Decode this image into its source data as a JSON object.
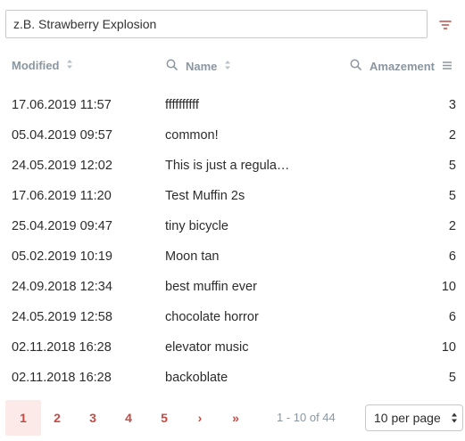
{
  "search": {
    "placeholder": "z.B. Strawberry Explosion",
    "value": ""
  },
  "filter": {
    "icon": "filter-icon"
  },
  "columns": {
    "modified": "Modified",
    "name": "Name",
    "amazement": "Amazement"
  },
  "rows": [
    {
      "modified": "17.06.2019 11:57",
      "name": "ffffffffff",
      "amazement": "3"
    },
    {
      "modified": "05.04.2019 09:57",
      "name": "common!",
      "amazement": "2"
    },
    {
      "modified": "24.05.2019 12:02",
      "name": "This is just a regula…",
      "amazement": "5"
    },
    {
      "modified": "17.06.2019 11:20",
      "name": "Test Muffin 2s",
      "amazement": "5"
    },
    {
      "modified": "25.04.2019 09:47",
      "name": "tiny bicycle",
      "amazement": "2"
    },
    {
      "modified": "05.02.2019 10:19",
      "name": "Moon tan",
      "amazement": "6"
    },
    {
      "modified": "24.09.2018 12:34",
      "name": "best muffin ever",
      "amazement": "10"
    },
    {
      "modified": "24.05.2019 12:58",
      "name": "chocolate horror",
      "amazement": "6"
    },
    {
      "modified": "02.11.2018 16:28",
      "name": "elevator music",
      "amazement": "10"
    },
    {
      "modified": "02.11.2018 16:28",
      "name": "backoblate",
      "amazement": "5"
    }
  ],
  "pagination": {
    "pages": [
      "1",
      "2",
      "3",
      "4",
      "5"
    ],
    "active_page": "1",
    "next": "›",
    "last": "»",
    "info": "1 - 10 of 44",
    "per_page": "10 per page"
  },
  "colors": {
    "accent": "#c44b44",
    "header": "#8a96a0",
    "active_bg": "#fbeae8"
  }
}
